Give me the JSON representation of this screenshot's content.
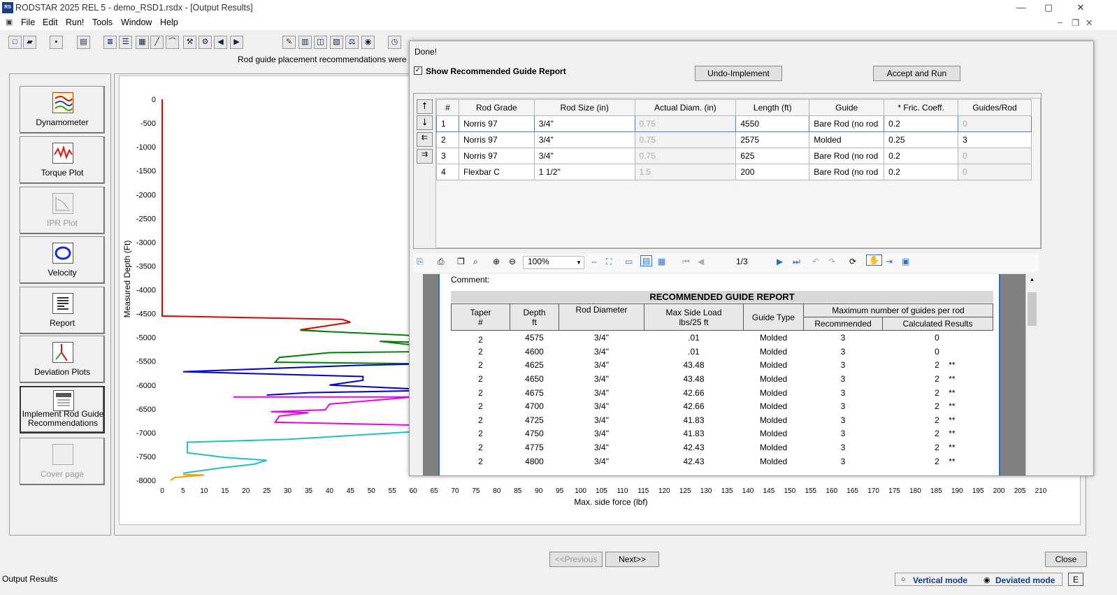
{
  "window": {
    "title": "RODSTAR 2025 REL 5 - demo_RSD1.rsdx - [Output Results]",
    "icon_text": "RS",
    "minimize": "—",
    "maximize": "▢",
    "close": "✕"
  },
  "menu": [
    "File",
    "Edit",
    "Run!",
    "Tools",
    "Window",
    "Help"
  ],
  "status_message": "Rod guide placement recommendations were not a",
  "nav": [
    {
      "label": "Dynamometer",
      "enabled": true
    },
    {
      "label": "Torque Plot",
      "enabled": true
    },
    {
      "label": "IPR Plot",
      "enabled": false
    },
    {
      "label": "Velocity",
      "enabled": true
    },
    {
      "label": "Report",
      "enabled": true
    },
    {
      "label": "Deviation Plots",
      "enabled": true
    },
    {
      "label": "Implement Rod Guide Recommendations",
      "enabled": true
    },
    {
      "label": "Cover page",
      "enabled": false
    }
  ],
  "chart_data": {
    "type": "line",
    "ylabel": "Measured Depth (Ft)",
    "xlabel": "Max. side force (lbf)",
    "ylim": [
      -8000,
      0
    ],
    "xlim": [
      0,
      210
    ],
    "yticks": [
      0,
      -500,
      -1000,
      -1500,
      -2000,
      -2500,
      -3000,
      -3500,
      -4000,
      -4500,
      -5000,
      -5500,
      -6000,
      -6500,
      -7000,
      -7500,
      -8000
    ],
    "xticks": [
      0,
      5,
      10,
      15,
      20,
      25,
      30,
      35,
      40,
      45,
      50,
      55,
      60,
      65,
      70,
      75,
      80,
      85,
      90,
      95,
      100,
      105,
      110,
      115,
      120,
      125,
      130,
      135,
      140,
      145,
      150,
      155,
      160,
      165,
      170,
      175,
      180,
      185,
      190,
      195,
      200,
      205,
      210
    ],
    "series": [
      {
        "color": "#e00000",
        "points": [
          [
            0,
            0
          ],
          [
            0,
            -4550
          ],
          [
            43,
            -4620
          ],
          [
            45,
            -4680
          ],
          [
            33,
            -4840
          ],
          [
            38,
            -4870
          ]
        ]
      },
      {
        "color": "#008000",
        "points": [
          [
            33,
            -4850
          ],
          [
            60,
            -4960
          ],
          [
            60,
            -5100
          ],
          [
            52,
            -5080
          ],
          [
            60,
            -5160
          ],
          [
            60,
            -5300
          ],
          [
            40,
            -5320
          ],
          [
            28,
            -5420
          ],
          [
            27,
            -5520
          ],
          [
            60,
            -5550
          ]
        ]
      },
      {
        "color": "#0000cc",
        "points": [
          [
            60,
            -5560
          ],
          [
            45,
            -5590
          ],
          [
            5,
            -5720
          ],
          [
            48,
            -5820
          ],
          [
            48,
            -5900
          ],
          [
            40,
            -6000
          ],
          [
            60,
            -6080
          ],
          [
            60,
            -6120
          ],
          [
            35,
            -6160
          ],
          [
            25,
            -6210
          ]
        ]
      },
      {
        "color": "#ee00ee",
        "points": [
          [
            17,
            -6250
          ],
          [
            60,
            -6250
          ],
          [
            40,
            -6400
          ],
          [
            39,
            -6520
          ],
          [
            26,
            -6560
          ],
          [
            35,
            -6580
          ],
          [
            28,
            -6650
          ],
          [
            27,
            -6780
          ],
          [
            60,
            -6840
          ]
        ]
      },
      {
        "color": "#20c0c0",
        "points": [
          [
            60,
            -6980
          ],
          [
            30,
            -7140
          ],
          [
            6,
            -7200
          ],
          [
            6,
            -7420
          ],
          [
            15,
            -7520
          ],
          [
            25,
            -7580
          ],
          [
            22,
            -7660
          ],
          [
            14,
            -7740
          ],
          [
            5,
            -7850
          ]
        ]
      },
      {
        "color": "#f0a000",
        "points": [
          [
            5,
            -7880
          ],
          [
            10,
            -7890
          ],
          [
            3,
            -7940
          ],
          [
            2,
            -8000
          ]
        ]
      }
    ]
  },
  "dialog": {
    "status": "Done!",
    "show_report_label": "Show Recommended Guide Report",
    "show_report_checked": true,
    "undo_label": "Undo-Implement",
    "accept_label": "Accept and Run",
    "grid_headers": [
      "#",
      "Rod Grade",
      "Rod Size (in)",
      "Actual Diam. (in)",
      "Length (ft)",
      "Guide",
      "* Fric. Coeff.",
      "Guides/Rod"
    ],
    "grid_rows": [
      [
        "1",
        "Norris 97",
        "3/4\"",
        "0.75",
        "4550",
        "Bare Rod (no rod",
        "0.2",
        "0"
      ],
      [
        "2",
        "Norris 97",
        "3/4\"",
        "0.75",
        "2575",
        "Molded",
        "0.25",
        "3"
      ],
      [
        "3",
        "Norris 97",
        "3/4\"",
        "0.75",
        "625",
        "Bare Rod (no rod",
        "0.2",
        "0"
      ],
      [
        "4",
        "Flexbar C",
        "1 1/2\"",
        "1.5",
        "200",
        "Bare Rod (no rod",
        "0.2",
        "0"
      ]
    ],
    "viewer": {
      "zoom": "100%",
      "page": "1/3"
    },
    "report": {
      "comment_label": "Comment:",
      "title": "RECOMMENDED GUIDE REPORT",
      "headers": {
        "taper": "Taper",
        "taper_sub": "#",
        "depth": "Depth",
        "depth_sub": "ft",
        "rod_diameter": "Rod Diameter",
        "max_side_load": "Max Side Load",
        "max_side_load_sub": "lbs/25 ft",
        "guide_type": "Guide Type",
        "max_guides": "Maximum number of guides per rod",
        "recommended": "Recommended",
        "calculated": "Calculated Results"
      },
      "rows": [
        [
          "2",
          "4575",
          "3/4\"",
          ".01",
          "Molded",
          "3",
          "0",
          ""
        ],
        [
          "2",
          "4600",
          "3/4\"",
          ".01",
          "Molded",
          "3",
          "0",
          ""
        ],
        [
          "2",
          "4625",
          "3/4\"",
          "43.48",
          "Molded",
          "3",
          "2",
          "**"
        ],
        [
          "2",
          "4650",
          "3/4\"",
          "43.48",
          "Molded",
          "3",
          "2",
          "**"
        ],
        [
          "2",
          "4675",
          "3/4\"",
          "42.66",
          "Molded",
          "3",
          "2",
          "**"
        ],
        [
          "2",
          "4700",
          "3/4\"",
          "42.66",
          "Molded",
          "3",
          "2",
          "**"
        ],
        [
          "2",
          "4725",
          "3/4\"",
          "41.83",
          "Molded",
          "3",
          "2",
          "**"
        ],
        [
          "2",
          "4750",
          "3/4\"",
          "41.83",
          "Molded",
          "3",
          "2",
          "**"
        ],
        [
          "2",
          "4775",
          "3/4\"",
          "42.43",
          "Molded",
          "3",
          "2",
          "**"
        ],
        [
          "2",
          "4800",
          "3/4\"",
          "42.43",
          "Molded",
          "3",
          "2",
          "**"
        ]
      ]
    }
  },
  "bottom": {
    "previous": "<<Previous",
    "next": "Next>>",
    "close": "Close",
    "status": "Output Results",
    "vertical_mode": "Vertical mode",
    "deviated_mode": "Deviated mode",
    "mode_selected": "deviated",
    "e_label": "E"
  }
}
